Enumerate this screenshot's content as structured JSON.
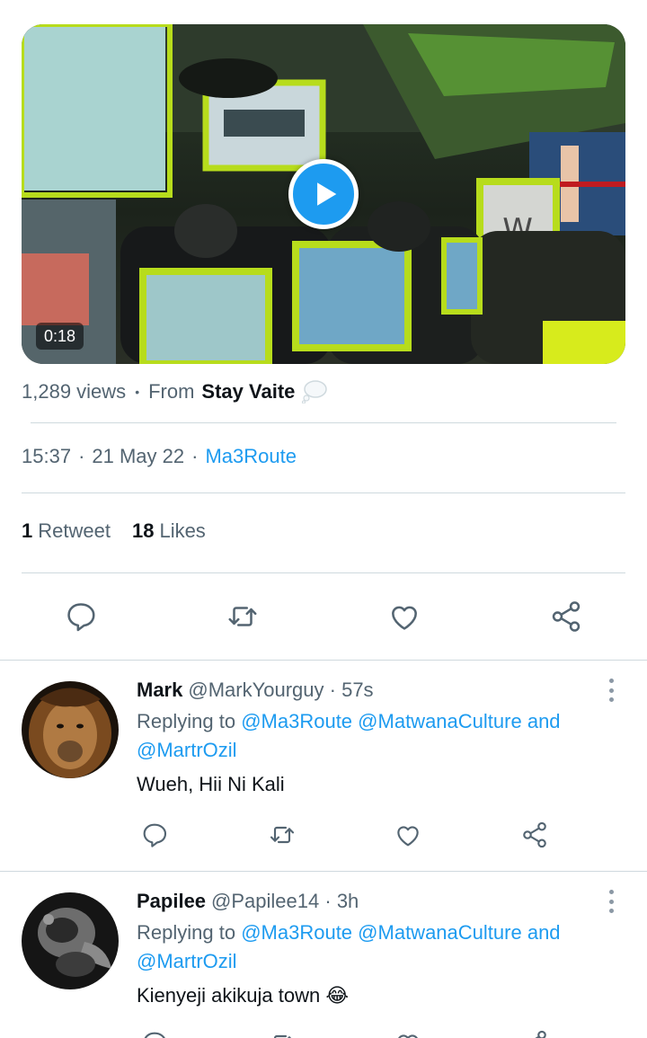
{
  "video": {
    "duration": "0:18",
    "play_icon": "play-icon"
  },
  "meta": {
    "views": "1,289 views",
    "separator": "•",
    "from_label": "From",
    "source_name": "Stay Vaite",
    "source_icon": "thought-bubble-icon"
  },
  "timestamp": {
    "time": "15:37",
    "separator": "·",
    "date": "21 May 22",
    "app": "Ma3Route"
  },
  "stats": {
    "retweets_count": "1",
    "retweets_label": "Retweet",
    "likes_count": "18",
    "likes_label": "Likes"
  },
  "actions": [
    "reply-icon",
    "retweet-icon",
    "like-icon",
    "share-icon"
  ],
  "replies": [
    {
      "name": "Mark",
      "handle": "@MarkYourguy",
      "time": "· 57s",
      "replying_prefix": "Replying to",
      "mention1": "@Ma3Route",
      "mention2": "@MatwanaCulture",
      "and": "and",
      "mention3": "@MartrOzil",
      "text": "Wueh, Hii Ni Kali",
      "avatar": "lion-avatar"
    },
    {
      "name": "Papilee",
      "handle": "@Papilee14",
      "time": "· 3h",
      "replying_prefix": "Replying to",
      "mention1": "@Ma3Route",
      "mention2": "@MatwanaCulture",
      "and": "and",
      "mention3": "@MartrOzil",
      "text": "Kienyeji akikuja town 😂",
      "avatar": "grayscale-avatar"
    }
  ],
  "colors": {
    "accent": "#1d9bf0",
    "secondary_text": "#536471",
    "primary_text": "#0f1419",
    "divider": "#cfd9de"
  }
}
